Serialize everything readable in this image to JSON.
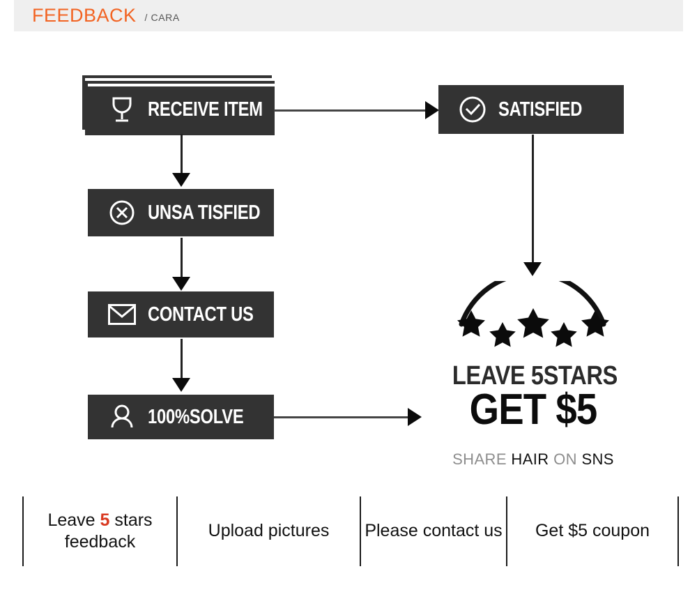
{
  "header": {
    "title": "FEEDBACK",
    "subtitle": "/ CARA",
    "accent_color": "#f26322",
    "subtitle_color": "#555555",
    "bar_background": "#efefef"
  },
  "theme": {
    "box_background": "#333333",
    "box_text_color": "#ffffff",
    "arrow_color": "#222222",
    "page_background": "#ffffff",
    "red_accent": "#d93a21"
  },
  "flow": {
    "boxes": [
      {
        "id": "receive-item",
        "label": "RECEIVE ITEM",
        "icon": "wine-glass-icon",
        "stacked": true
      },
      {
        "id": "unsatisfied",
        "label": "UNSA TISFIED",
        "icon": "x-circle-icon",
        "stacked": false
      },
      {
        "id": "contact-us",
        "label": "CONTACT US",
        "icon": "envelope-icon",
        "stacked": false
      },
      {
        "id": "solve",
        "label": "100%SOLVE",
        "icon": "person-icon",
        "stacked": false
      },
      {
        "id": "satisfied",
        "label": "SATISFIED",
        "icon": "check-circle-icon",
        "stacked": false
      }
    ],
    "arrows": [
      {
        "id": "receive-to-satisfied",
        "direction": "right"
      },
      {
        "id": "receive-to-unsatisfied",
        "direction": "down"
      },
      {
        "id": "unsatisfied-to-contact",
        "direction": "down"
      },
      {
        "id": "contact-to-solve",
        "direction": "down"
      },
      {
        "id": "satisfied-to-stars",
        "direction": "down"
      },
      {
        "id": "solve-to-stars",
        "direction": "right"
      }
    ]
  },
  "promo": {
    "stars_count": 5,
    "line1": "LEAVE 5STARS",
    "line2": "GET $5",
    "line3": [
      {
        "text": "SHARE",
        "color": "gray"
      },
      {
        "text": "HAIR",
        "color": "black"
      },
      {
        "text": "ON",
        "color": "gray"
      },
      {
        "text": "SNS",
        "color": "black"
      }
    ]
  },
  "bottom": {
    "cells": [
      {
        "id": "leave-5-stars-feedback",
        "pre": "Leave ",
        "highlight": "5",
        "post": " stars feedback"
      },
      {
        "id": "upload-pictures",
        "text": "Upload pictures"
      },
      {
        "id": "please-contact-us",
        "text": "Please contact us"
      },
      {
        "id": "get-5-coupon",
        "text": "Get $5 coupon"
      }
    ]
  }
}
